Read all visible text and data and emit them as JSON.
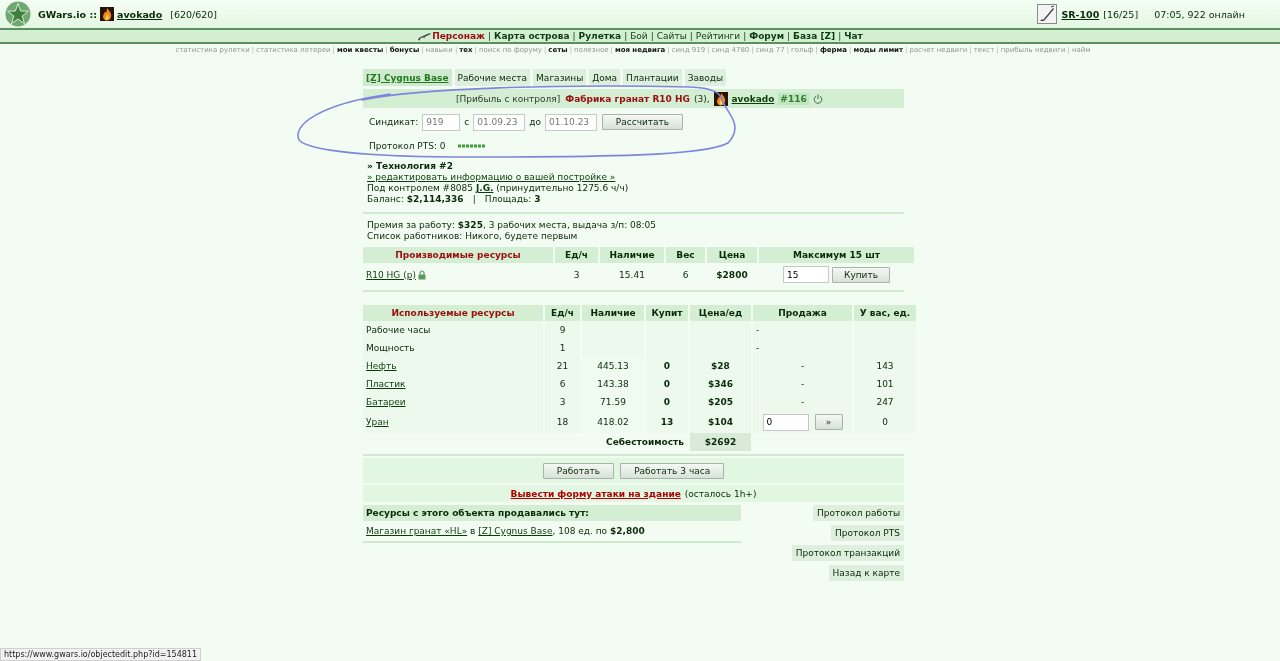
{
  "header": {
    "site": "GWars.io ::",
    "user": {
      "name": "avokado",
      "hp": "[620/620]"
    },
    "weapon": {
      "name": "SR-100",
      "count": "[16/25]"
    },
    "status": "07:05, 922 онлайн"
  },
  "nav": {
    "separator": "|",
    "items": [
      {
        "label": "Персонаж",
        "selected": true,
        "emphasized": true
      },
      {
        "label": "Карта острова",
        "selected": false,
        "emphasized": true
      },
      {
        "label": "Рулетка",
        "selected": false,
        "emphasized": true
      },
      {
        "label": "Бой",
        "selected": false,
        "emphasized": false
      },
      {
        "label": "Сайты",
        "selected": false,
        "emphasized": false
      },
      {
        "label": "Рейтинги",
        "selected": false,
        "emphasized": false
      },
      {
        "label": "Форум",
        "selected": false,
        "emphasized": true
      },
      {
        "label": "База [Z]",
        "selected": false,
        "emphasized": true
      },
      {
        "label": "Чат",
        "selected": false,
        "emphasized": true
      }
    ]
  },
  "sublinks": {
    "separator": "|",
    "items": [
      {
        "label": "статистика рулетки",
        "emphasized": false
      },
      {
        "label": "статистика лотереи",
        "emphasized": false
      },
      {
        "label": "мои квесты",
        "emphasized": true
      },
      {
        "label": "бонусы",
        "emphasized": true
      },
      {
        "label": "навыки",
        "emphasized": false
      },
      {
        "label": "тех",
        "emphasized": true
      },
      {
        "label": "поиск по форуму",
        "emphasized": false
      },
      {
        "label": "сеты",
        "emphasized": true
      },
      {
        "label": "полезное",
        "emphasized": false
      },
      {
        "label": "моя недвига",
        "emphasized": true
      },
      {
        "label": "синд 919",
        "emphasized": false
      },
      {
        "label": "синд 4780",
        "emphasized": false
      },
      {
        "label": "синд 77",
        "emphasized": false
      },
      {
        "label": "гольф",
        "emphasized": false
      },
      {
        "label": "ферма",
        "emphasized": true
      },
      {
        "label": "моды лимит",
        "emphasized": true
      },
      {
        "label": "расчет недвиги",
        "emphasized": false
      },
      {
        "label": "текст",
        "emphasized": false
      },
      {
        "label": "прибыль недвиги",
        "emphasized": false
      },
      {
        "label": "найм",
        "emphasized": false
      }
    ]
  },
  "tabs": [
    {
      "label": "[Z] Cygnus Base",
      "selected": true
    },
    {
      "label": "Рабочие места",
      "selected": false
    },
    {
      "label": "Магазины",
      "selected": false
    },
    {
      "label": "Дома",
      "selected": false
    },
    {
      "label": "Плантации",
      "selected": false
    },
    {
      "label": "Заводы",
      "selected": false
    }
  ],
  "object": {
    "tag": "[Прибыль с контроля]",
    "name": "Фабрика гранат R10 HG",
    "count": "(3),",
    "owner": "avokado",
    "number": "#116"
  },
  "calc_form": {
    "syndicate_label": "Синдикат:",
    "syndicate": "919",
    "from_label": "с",
    "from": "01.09.23",
    "to_label": "до",
    "to": "01.10.23",
    "button": "Рассчитать"
  },
  "pts": "Протокол PTS: 0",
  "info": {
    "technology": "» Технология #2",
    "edit_link": "» редактировать информацию о вашей постройке »",
    "control_before": "Под контролем #8085",
    "controller": "J.G.",
    "control_after": "(принудительно 1275.6 ч/ч)",
    "balance": "Баланс: **$2,114,336**",
    "separator": "|",
    "area": "Площадь: **3**"
  },
  "work": {
    "bonus": "Премия за работу: **$325**, 3 рабочих места, выдача з/п: 08:05",
    "workers": "Список работников: Никого, будете первым"
  },
  "produced": {
    "columns": [
      "Производимые ресурсы",
      "Ед/ч",
      "Наличие",
      "Вес",
      "Цена",
      "Максимум **15 шт**"
    ],
    "rows": [
      {
        "name": "R10 HG (р)",
        "locked": true,
        "rate": "3",
        "stock": "15.41",
        "weight": "6",
        "price": "$2800",
        "quantity": "15",
        "button": "Купить"
      }
    ]
  },
  "used": {
    "columns": [
      "Используемые ресурсы",
      "Ед/ч",
      "Наличие",
      "Купит",
      "Цена/ед",
      "Продажа",
      "У вас, ед."
    ],
    "rows": [
      {
        "kind": "plain",
        "name": "Рабочие часы",
        "rate": "9",
        "sale": "-"
      },
      {
        "kind": "plain",
        "name": "Мощность",
        "rate": "1",
        "sale": "-"
      },
      {
        "kind": "resource",
        "name": "Нефть",
        "rate": "21",
        "stock": "445.13",
        "buy": "0",
        "price": "$28",
        "sale": "-",
        "owned": "143"
      },
      {
        "kind": "resource",
        "name": "Пластик",
        "rate": "6",
        "stock": "143.38",
        "buy": "0",
        "price": "$346",
        "sale": "-",
        "owned": "101"
      },
      {
        "kind": "resource",
        "name": "Батареи",
        "rate": "3",
        "stock": "71.59",
        "buy": "0",
        "price": "$205",
        "sale": "-",
        "owned": "247"
      },
      {
        "kind": "sellable",
        "name": "Уран",
        "rate": "18",
        "stock": "418.02",
        "buy": "13",
        "price": "$104",
        "sale_value": "0",
        "sale_button": "»",
        "owned": "0"
      }
    ],
    "cost_label": "Себестоимость",
    "cost": "$2692"
  },
  "actions": [
    "Работать",
    "Работать 3 часа"
  ],
  "attack": {
    "link": "Вывести форму атаки на здание",
    "note": "(осталось 1h+)"
  },
  "sold_at": {
    "title": "Ресурсы с этого объекта продавались тут:",
    "entries": [
      {
        "shop": "Магазин гранат «HL»",
        "connector": "в",
        "base": "[Z] Cygnus Base",
        "details": ", 108 ед. по **$2,800**"
      }
    ]
  },
  "side_links": [
    "Протокол работы",
    "Протокол PTS",
    "Протокол транзакций",
    "Назад к карте"
  ],
  "status_bar": "https://www.gwars.io/objectedit.php?id=154811"
}
